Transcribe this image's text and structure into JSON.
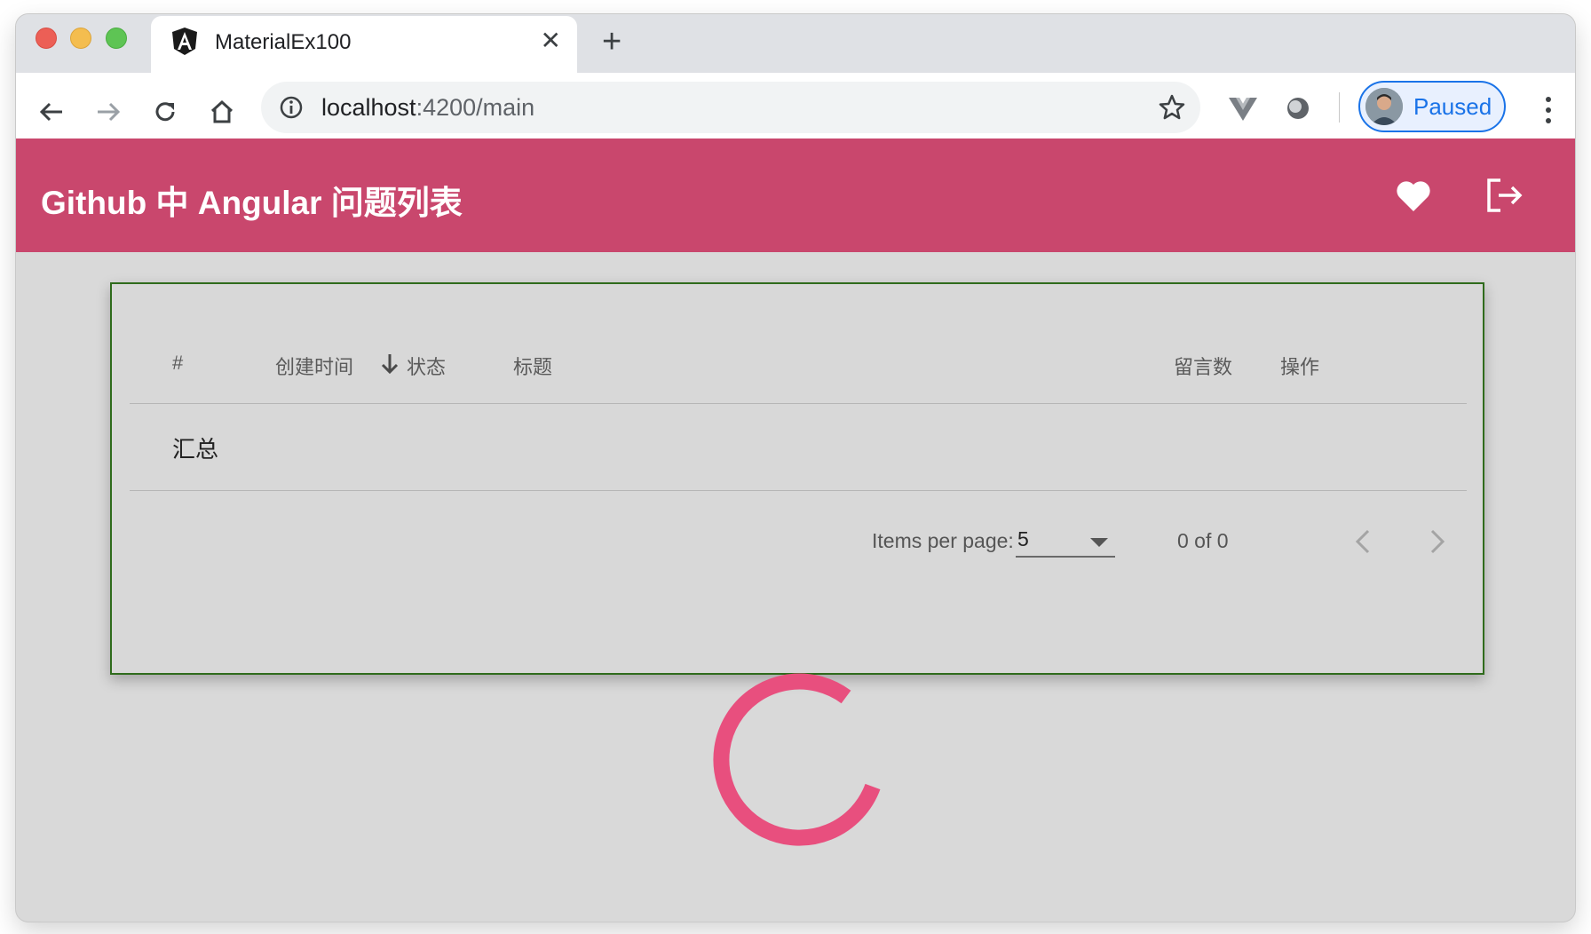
{
  "browser": {
    "tab_title": "MaterialEx100",
    "tab_close": "✕",
    "new_tab": "+",
    "url_host": "localhost",
    "url_rest": ":4200/main",
    "profile_label": "Paused"
  },
  "app": {
    "title": "Github 中 Angular 问题列表"
  },
  "table": {
    "columns": {
      "number": "#",
      "created": "创建时间",
      "status": "状态",
      "title": "标题",
      "comments": "留言数",
      "actions": "操作"
    },
    "summary_label": "汇总"
  },
  "paginator": {
    "items_per_page_label": "Items per page:",
    "page_size": "5",
    "range_label": "0 of 0"
  },
  "colors": {
    "primary": "#c9476d",
    "spinner": "#e84f7e",
    "profile_accent": "#1a73e8"
  }
}
